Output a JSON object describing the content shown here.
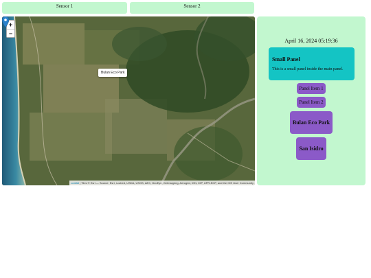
{
  "tabs": [
    {
      "label": "Sensor 1"
    },
    {
      "label": "Sensor 2"
    }
  ],
  "map": {
    "zoom_in": "+",
    "zoom_out": "−",
    "popup_label": "Bulan Eco Park",
    "attribution": {
      "leaflet": "Leaflet",
      "rest": "| Tiles © Esri — Source: Esri, i-cubed, USDA, USGS, AEX, GeoEye, Getmapping, Aerogrid, IGN, IGP, UPR-EGP, and the GIS User Community"
    },
    "marker_color": "#2a81cb"
  },
  "panel": {
    "timestamp": "April 16, 2024 05:19:36",
    "small_panel": {
      "title": "Small Panel",
      "text": "This is a small panel inside the main panel."
    },
    "items": [
      "Panel Item 1",
      "Panel Item 2",
      "Bulan Eco Park",
      "San Isidro"
    ]
  },
  "colors": {
    "panel_bg": "#c2f7cf",
    "small_panel_bg": "#14c4c4",
    "item_bg": "#8b5ac8"
  }
}
